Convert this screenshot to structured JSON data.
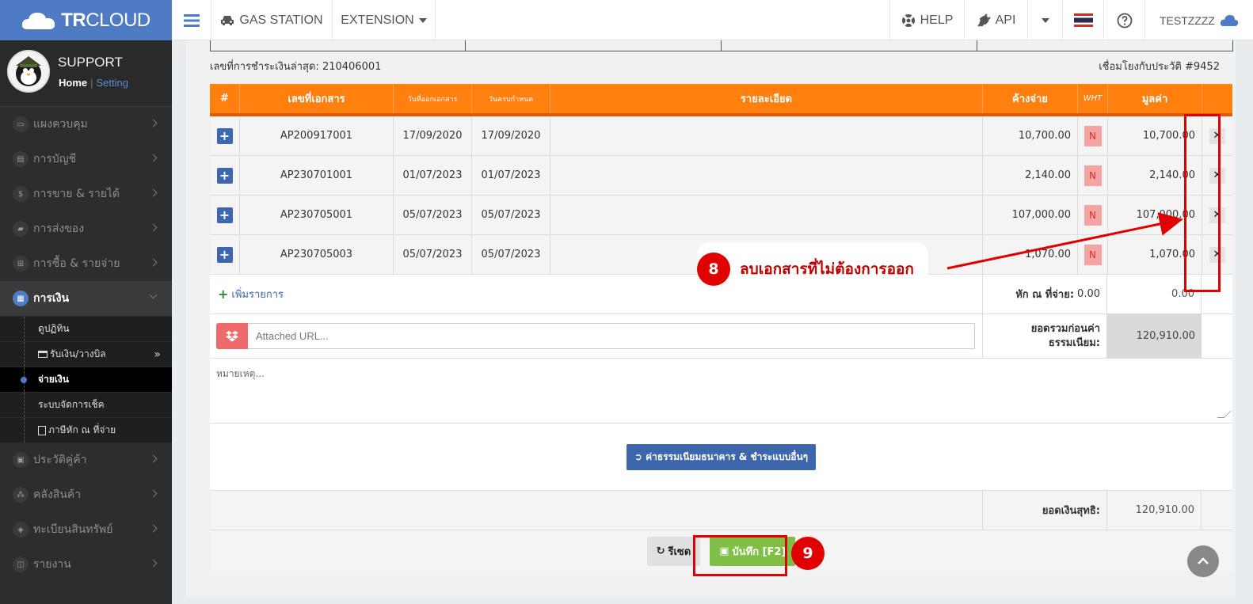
{
  "topbar": {
    "brand_bold": "TR",
    "brand_rest": "CLOUD",
    "gas_station": "GAS STATION",
    "extension": "EXTENSION",
    "help": "HELP",
    "api": "API",
    "user": "TESTZZZZ",
    "icons": [
      "menu-icon",
      "car-icon",
      "lifebuoy-icon",
      "plug-icon",
      "thai-flag-icon",
      "question-icon",
      "cloud-icon"
    ]
  },
  "sidebar": {
    "profile_name": "SUPPORT",
    "home": "Home",
    "sep": "|",
    "setting": "Setting",
    "items": [
      {
        "label": "แผงควบคุม"
      },
      {
        "label": "การบัญชี"
      },
      {
        "label": "การขาย & รายได้"
      },
      {
        "label": "การส่งของ"
      },
      {
        "label": "การซื้อ & รายจ่าย"
      },
      {
        "label": "การเงิน"
      }
    ],
    "subitems": [
      {
        "label": "ดูปฏิทิน"
      },
      {
        "label": "รับเงิน/วางบิล"
      },
      {
        "label": "จ่ายเงิน"
      },
      {
        "label": "ระบบจัดการเช็ค"
      },
      {
        "label": "ภาษีหัก ณ ที่จ่าย"
      }
    ],
    "items_after": [
      {
        "label": "ประวัติคู่ค้า"
      },
      {
        "label": "คลังสินค้า"
      },
      {
        "label": "ทะเบียนสินทรัพย์"
      },
      {
        "label": "รายงาน"
      }
    ]
  },
  "main": {
    "last_payment": "เลขที่การชำระเงินล่าสุด: 210406001",
    "link_history": "เชื่อมโยงกับประวัติ #9452",
    "headers": [
      "#",
      "เลขที่เอกสาร",
      "วันที่ออกเอกสาร",
      "วันครบกำหนด",
      "รายละเอียด",
      "ค้างจ่าย",
      "WHT",
      "มูลค่า"
    ],
    "rows": [
      {
        "doc": "AP200917001",
        "issue": "17/09/2020",
        "due": "17/09/2020",
        "detail": "",
        "outstanding": "10,700.00",
        "wht": "N",
        "amount": "10,700.00"
      },
      {
        "doc": "AP230701001",
        "issue": "01/07/2023",
        "due": "01/07/2023",
        "detail": "",
        "outstanding": "2,140.00",
        "wht": "N",
        "amount": "2,140.00"
      },
      {
        "doc": "AP230705001",
        "issue": "05/07/2023",
        "due": "05/07/2023",
        "detail": "",
        "outstanding": "107,000.00",
        "wht": "N",
        "amount": "107,000.00"
      },
      {
        "doc": "AP230705003",
        "issue": "05/07/2023",
        "due": "05/07/2023",
        "detail": "",
        "outstanding": "1,070.00",
        "wht": "N",
        "amount": "1,070.00"
      }
    ],
    "add_item": "เพิ่มรายการ",
    "wht_label": "หัก ณ ที่จ่าย:",
    "wht_value": "0.00",
    "wht_total": "0.00",
    "url_placeholder": "Attached URL...",
    "pre_fee_label_1": "ยอดรวมก่อนค่า",
    "pre_fee_label_2": "ธรรมเนียม:",
    "pre_fee_value": "120,910.00",
    "note_placeholder": "หมายเหตุ...",
    "fee_button": "ค่าธรรมเนียมธนาคาร & ชำระแบบอื่นๆ",
    "net_label": "ยอดเงินสุทธิ:",
    "net_value": "120,910.00",
    "reset": "รีเซต",
    "save": "บันทึก [F2]"
  },
  "annotations": {
    "step8_num": "8",
    "step8_text": "ลบเอกสารที่ไม่ต้องการออก",
    "step9_num": "9"
  },
  "colors": {
    "brand": "#4e7bc4",
    "table_header": "#ff7f0f",
    "save": "#7fbf46",
    "annotation": "#e00000"
  }
}
